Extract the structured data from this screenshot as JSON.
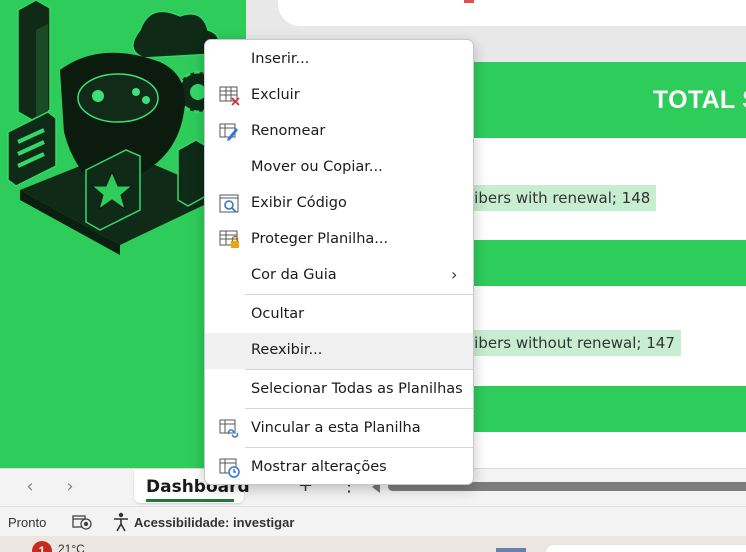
{
  "sheet": {
    "total_title": "TOTAL S",
    "label_renewal": "ribers with renewal; 148",
    "label_no_renewal": "ribers without renewal; 147"
  },
  "tabs": {
    "prev_icon": "‹",
    "next_icon": "›",
    "active_tab": "Dashboard",
    "add_icon": "+",
    "options_icon": "⋮"
  },
  "status": {
    "ready": "Pronto",
    "accessibility": "Acessibilidade: investigar"
  },
  "taskbar": {
    "notification_count": "1",
    "weather": "21°C"
  },
  "context_menu": {
    "items": [
      {
        "label": "Inserir...",
        "icon": "none"
      },
      {
        "label": "Excluir",
        "icon": "delete-sheet-icon"
      },
      {
        "label": "Renomear",
        "icon": "rename-sheet-icon"
      },
      {
        "label": "Mover ou Copiar...",
        "icon": "none"
      },
      {
        "label": "Exibir Código",
        "icon": "view-code-icon"
      },
      {
        "label": "Proteger Planilha...",
        "icon": "protect-sheet-icon"
      },
      {
        "label": "Cor da Guia",
        "icon": "none",
        "submenu": true
      },
      {
        "label": "Ocultar",
        "icon": "none"
      },
      {
        "label": "Reexibir...",
        "icon": "none",
        "hovered": true
      },
      {
        "label": "Selecionar Todas as Planilhas",
        "icon": "none"
      },
      {
        "label": "Vincular a esta Planilha",
        "icon": "link-sheet-icon"
      },
      {
        "label": "Mostrar alterações",
        "icon": "show-changes-icon"
      }
    ],
    "submenu_arrow": "›"
  },
  "colors": {
    "brand_green": "#2ecc5b",
    "label_bg": "#c7eed0",
    "menu_hover": "#f0f0f0"
  }
}
